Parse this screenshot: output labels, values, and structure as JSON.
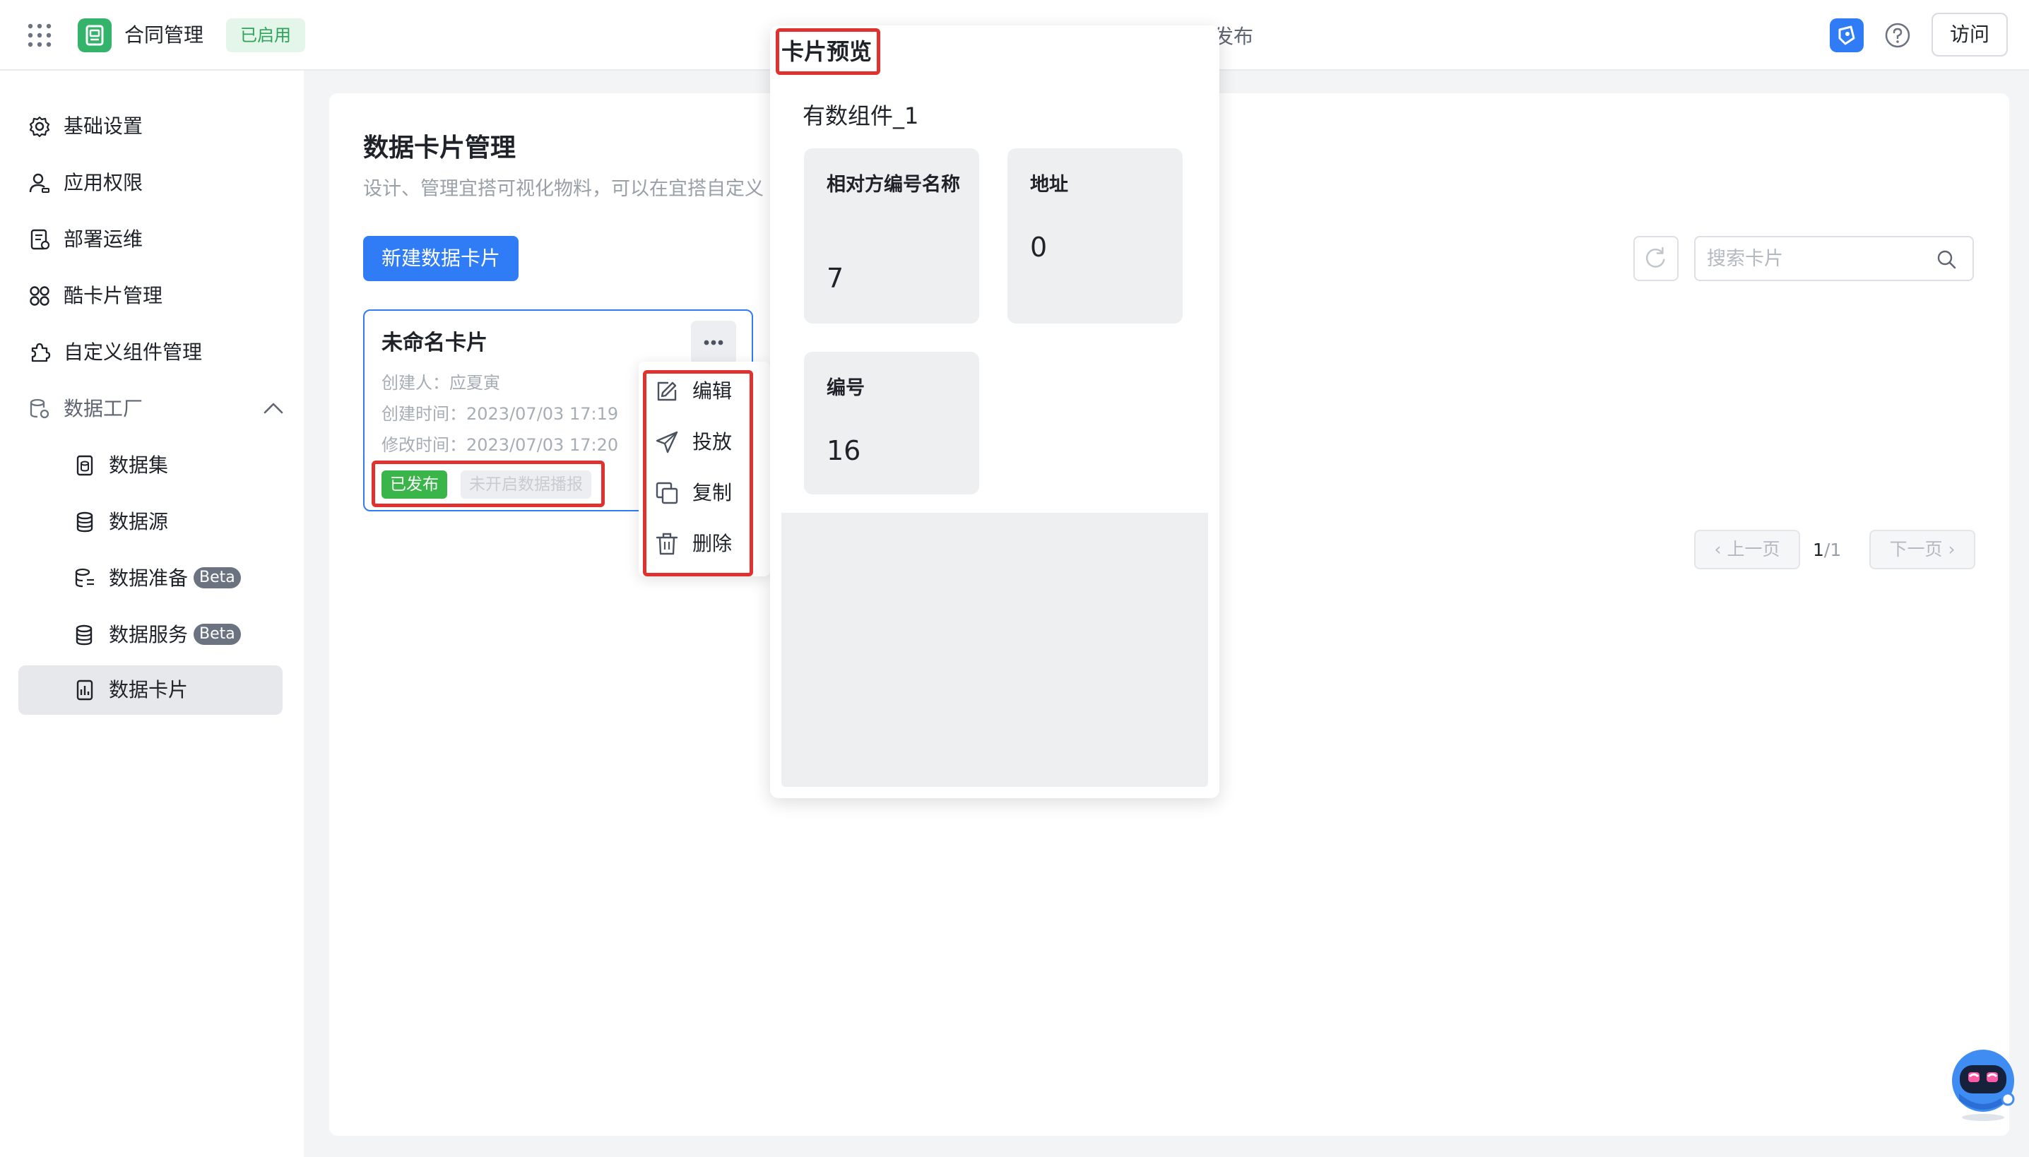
{
  "header": {
    "app_name": "合同管理",
    "app_status": "已启用",
    "partial_tab_text": "发布",
    "visit_label": "访问"
  },
  "sidebar": {
    "items": [
      {
        "label": "基础设置",
        "icon": "gear-icon"
      },
      {
        "label": "应用权限",
        "icon": "user-permission-icon"
      },
      {
        "label": "部署运维",
        "icon": "deploy-icon"
      },
      {
        "label": "酷卡片管理",
        "icon": "grid-icon"
      },
      {
        "label": "自定义组件管理",
        "icon": "puzzle-icon"
      },
      {
        "label": "数据工厂",
        "icon": "data-factory-icon"
      }
    ],
    "sub_items": [
      {
        "label": "数据集",
        "badge": ""
      },
      {
        "label": "数据源",
        "badge": ""
      },
      {
        "label": "数据准备",
        "badge": "Beta"
      },
      {
        "label": "数据服务",
        "badge": "Beta"
      },
      {
        "label": "数据卡片",
        "badge": ""
      }
    ]
  },
  "main": {
    "title": "数据卡片管理",
    "description": "设计、管理宜搭可视化物料，可以在宜搭自定义",
    "new_button": "新建数据卡片",
    "search_placeholder": "搜索卡片",
    "pager": {
      "prev": "上一页",
      "next": "下一页",
      "current": "1",
      "total": "/1"
    }
  },
  "card": {
    "title": "未命名卡片",
    "creator": "创建人：应夏寅",
    "created": "创建时间：2023/07/03 17:19",
    "modified": "修改时间：2023/07/03 17:20",
    "tag_published": "已发布",
    "tag_broadcast": "未开启数据播报"
  },
  "menu": {
    "items": [
      "编辑",
      "投放",
      "复制",
      "删除"
    ]
  },
  "preview": {
    "title": "卡片预览",
    "widget_title": "有数组件_1",
    "metrics": [
      {
        "label": "相对方编号名称",
        "value": "7"
      },
      {
        "label": "地址",
        "value": "0"
      },
      {
        "label": "编号",
        "value": "16"
      }
    ]
  },
  "colors": {
    "primary": "#2f7cf6",
    "success": "#3ab54a",
    "highlight": "#e0312e",
    "app_logo": "#34b36b"
  }
}
